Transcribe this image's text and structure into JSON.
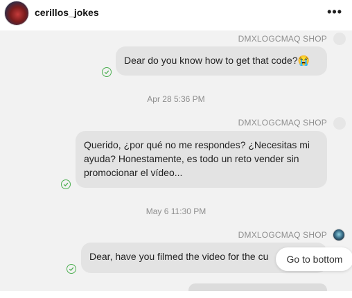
{
  "header": {
    "username": "cerillos_jokes",
    "more_icon": "more-horizontal-icon"
  },
  "messages": [
    {
      "sender": "DMXLOGCMAQ SHOP",
      "text": "Dear do you know how to get that code?😭",
      "status": "sent"
    },
    {
      "sender": "DMXLOGCMAQ SHOP",
      "text": "Querido, ¿por qué no me respondes? ¿Necesitas mi ayuda? Honestamente, es todo un reto vender sin promocionar el vídeo...",
      "status": "sent"
    },
    {
      "sender": "DMXLOGCMAQ SHOP",
      "text": "Dear, have you filmed the video for the cu",
      "status": "sent"
    }
  ],
  "timestamps": [
    "Apr 28 5:36 PM",
    "May 6 11:30 PM"
  ],
  "go_to_bottom": "Go to bottom",
  "colors": {
    "bubble": "#e3e3e3",
    "check": "#4caf50",
    "meta": "#8e8e8e"
  }
}
